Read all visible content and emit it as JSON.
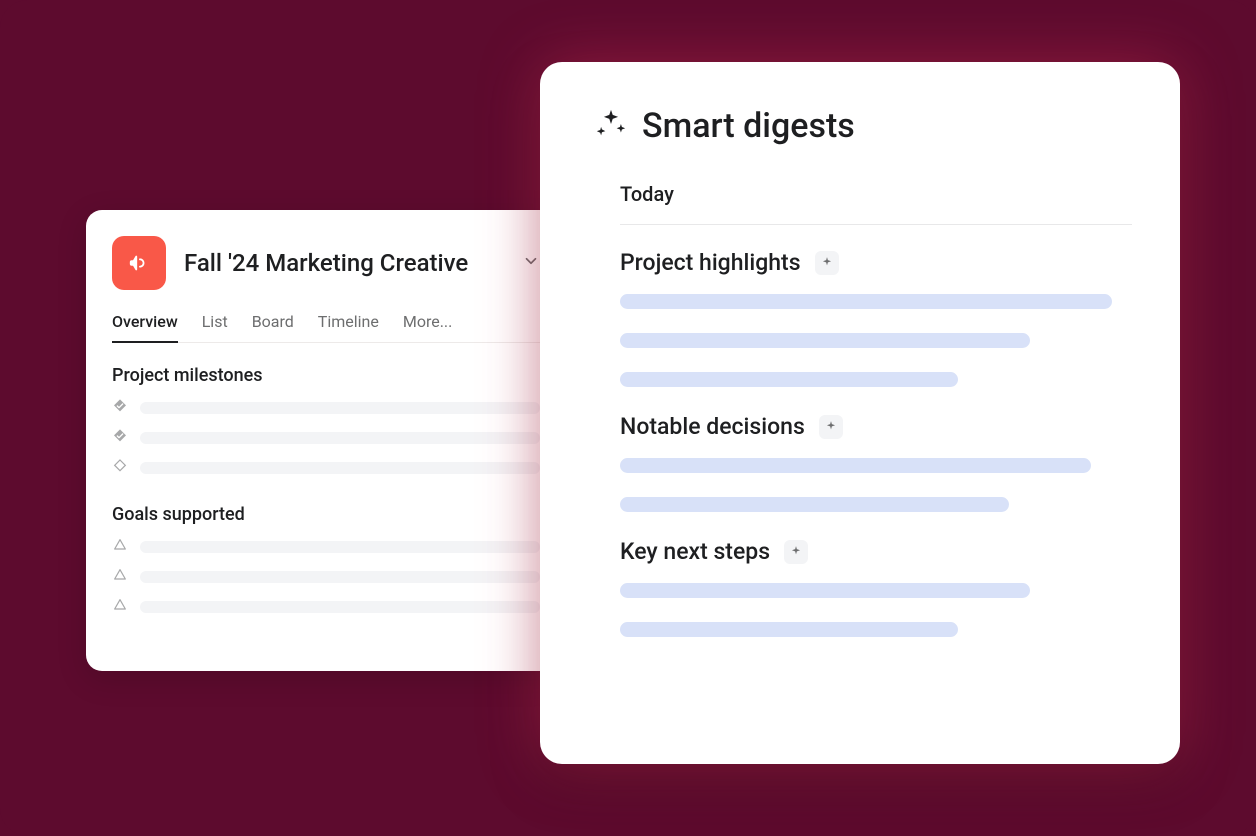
{
  "project": {
    "title": "Fall '24 Marketing Creative",
    "icon": "megaphone-icon",
    "icon_bg": "#f95848",
    "tabs": [
      {
        "label": "Overview",
        "active": true
      },
      {
        "label": "List",
        "active": false
      },
      {
        "label": "Board",
        "active": false
      },
      {
        "label": "Timeline",
        "active": false
      },
      {
        "label": "More...",
        "active": false
      }
    ],
    "sections": [
      {
        "heading": "Project milestones",
        "icon_type": "milestone",
        "rows": [
          {
            "complete": true
          },
          {
            "complete": true
          },
          {
            "complete": false
          }
        ]
      },
      {
        "heading": "Goals supported",
        "icon_type": "goal",
        "rows": [
          {
            "complete": false
          },
          {
            "complete": false
          },
          {
            "complete": false
          }
        ]
      }
    ]
  },
  "digest": {
    "title": "Smart digests",
    "date": "Today",
    "sections": [
      {
        "title": "Project highlights",
        "bars": [
          96,
          80,
          66
        ]
      },
      {
        "title": "Notable decisions",
        "bars": [
          92,
          76
        ]
      },
      {
        "title": "Key next steps",
        "bars": [
          80,
          66
        ]
      }
    ]
  },
  "colors": {
    "background": "#5d0b2e",
    "digest_bar": "#d8e1f8",
    "placeholder": "#f3f4f6"
  }
}
